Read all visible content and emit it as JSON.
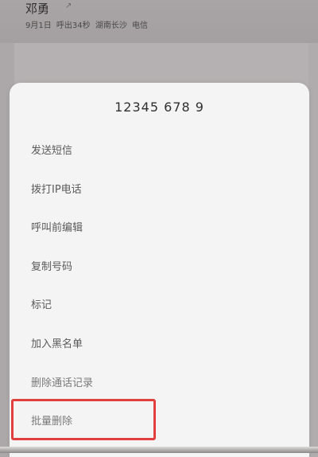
{
  "call_log_entry": {
    "name": "邓勇",
    "date": "9月1日",
    "call_info": "呼出34秒",
    "location": "湖南长沙",
    "carrier": "电信"
  },
  "menu": {
    "phone_number": "12345 678 9",
    "items": [
      {
        "label": "发送短信"
      },
      {
        "label": "拨打IP电话"
      },
      {
        "label": "呼叫前编辑"
      },
      {
        "label": "复制号码"
      },
      {
        "label": "标记"
      },
      {
        "label": "加入黑名单"
      },
      {
        "label": "删除通话记录"
      },
      {
        "label": "批量删除"
      }
    ]
  },
  "colors": {
    "highlight_border": "#e13e3e",
    "menu_background": "#f4f4f4",
    "overlay": "#9c9697"
  }
}
